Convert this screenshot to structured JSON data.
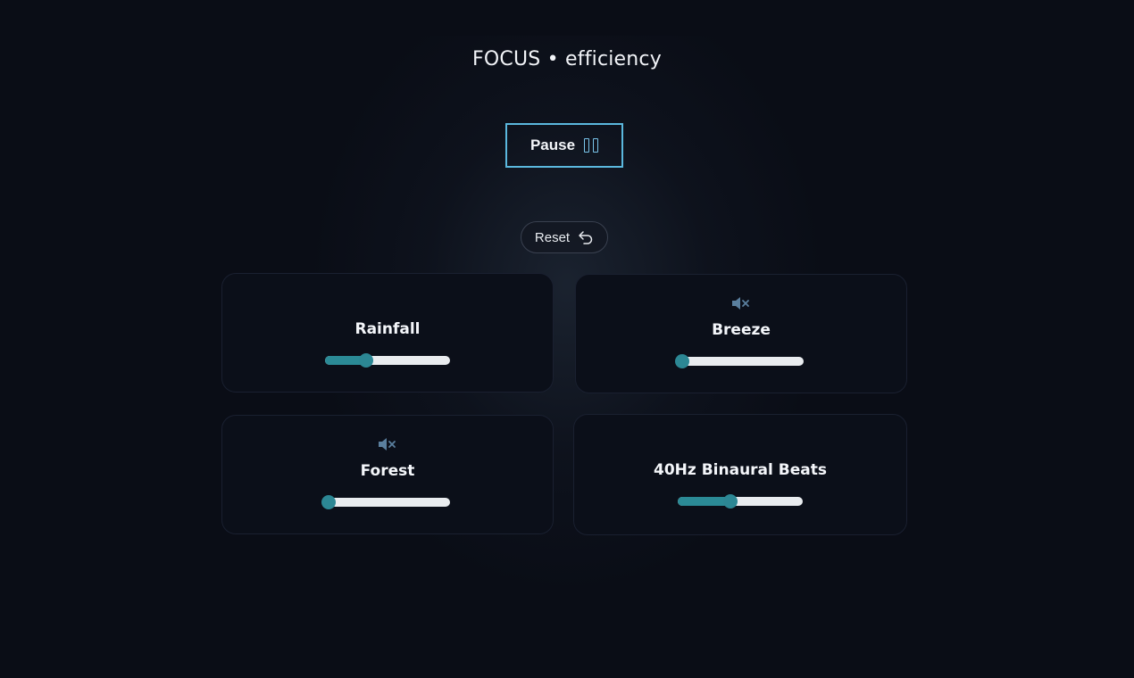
{
  "header": {
    "title": "FOCUS • efficiency"
  },
  "controls": {
    "pause_label": "Pause",
    "reset_label": "Reset"
  },
  "colors": {
    "background": "#0a0d16",
    "accent": "#5bb8de",
    "active_label": "#7fc6f0",
    "slider_fill": "#2b8a96",
    "slider_track": "#e9ecef",
    "muted_icon": "#5a7f9e"
  },
  "sounds": [
    {
      "name": "Rainfall",
      "volume": 0.33,
      "active": true,
      "muted": false,
      "icon": "none"
    },
    {
      "name": "Breeze",
      "volume": 0.0,
      "active": false,
      "muted": true,
      "icon": "speaker-muted-icon"
    },
    {
      "name": "Forest",
      "volume": 0.0,
      "active": false,
      "muted": true,
      "icon": "speaker-muted-icon"
    },
    {
      "name": "40Hz Binaural Beats",
      "volume": 0.42,
      "active": true,
      "muted": false,
      "icon": "none"
    }
  ]
}
